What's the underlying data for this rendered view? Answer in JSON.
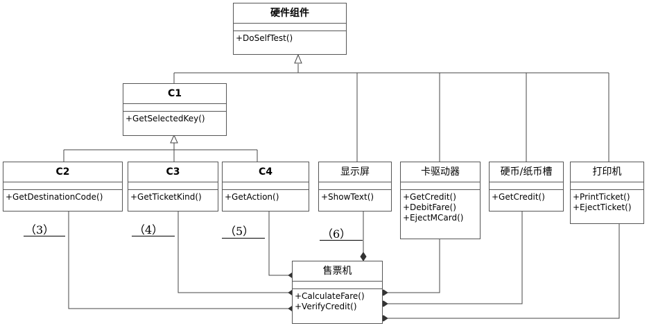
{
  "classes": {
    "hw": {
      "name": "硬件组件",
      "ops": [
        "+DoSelfTest()"
      ]
    },
    "c1": {
      "name": "C1",
      "ops": [
        "+GetSelectedKey()"
      ]
    },
    "c2": {
      "name": "C2",
      "ops": [
        "+GetDestinationCode()"
      ]
    },
    "c3": {
      "name": "C3",
      "ops": [
        "+GetTicketKind()"
      ]
    },
    "c4": {
      "name": "C4",
      "ops": [
        "+GetAction()"
      ]
    },
    "disp": {
      "name": "显示屏",
      "ops": [
        "+ShowText()"
      ]
    },
    "card": {
      "name": "卡驱动器",
      "ops": [
        "+GetCredit()",
        "+DebitFare()",
        "+EjectMCard()"
      ]
    },
    "coin": {
      "name": "硬币/纸币槽",
      "ops": [
        "+GetCredit()"
      ]
    },
    "print": {
      "name": "打印机",
      "ops": [
        "+PrintTicket()",
        "+EjectTicket()"
      ]
    },
    "tvm": {
      "name": "售票机",
      "ops": [
        "+CalculateFare()",
        "+VerifyCredit()"
      ]
    }
  },
  "blanks": {
    "b3": "（3）",
    "b4": "（4）",
    "b5": "（5）",
    "b6": "（6）"
  }
}
